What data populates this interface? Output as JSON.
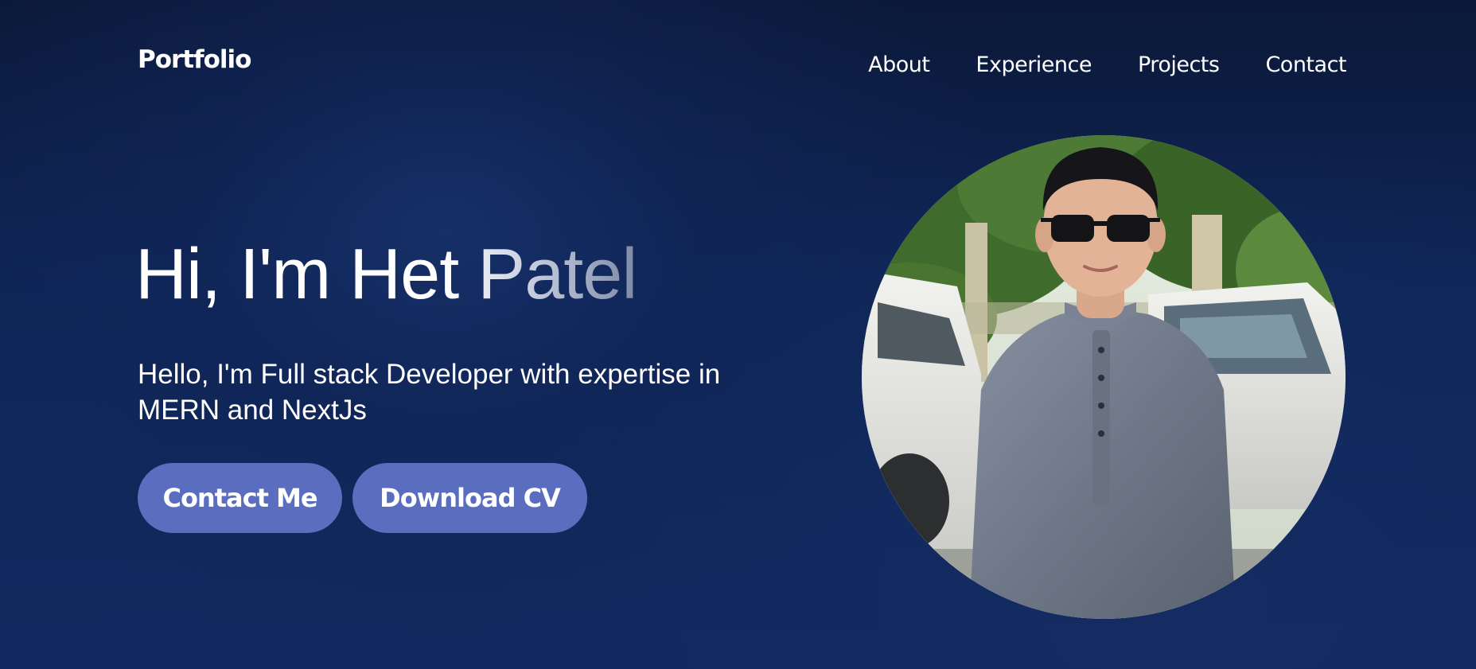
{
  "header": {
    "brand": "Portfolio",
    "nav": [
      "About",
      "Experience",
      "Projects",
      "Contact"
    ]
  },
  "hero": {
    "title": "Hi, I'm Het Patel",
    "subtitle": "Hello, I'm Full stack Developer with expertise in MERN and NextJs",
    "buttons": {
      "contact": "Contact Me",
      "download": "Download CV"
    }
  },
  "colors": {
    "background": "#0f2556",
    "button": "#5a6dbf",
    "text": "#ffffff"
  },
  "icons": {
    "profile_photo": "profile-photo"
  }
}
